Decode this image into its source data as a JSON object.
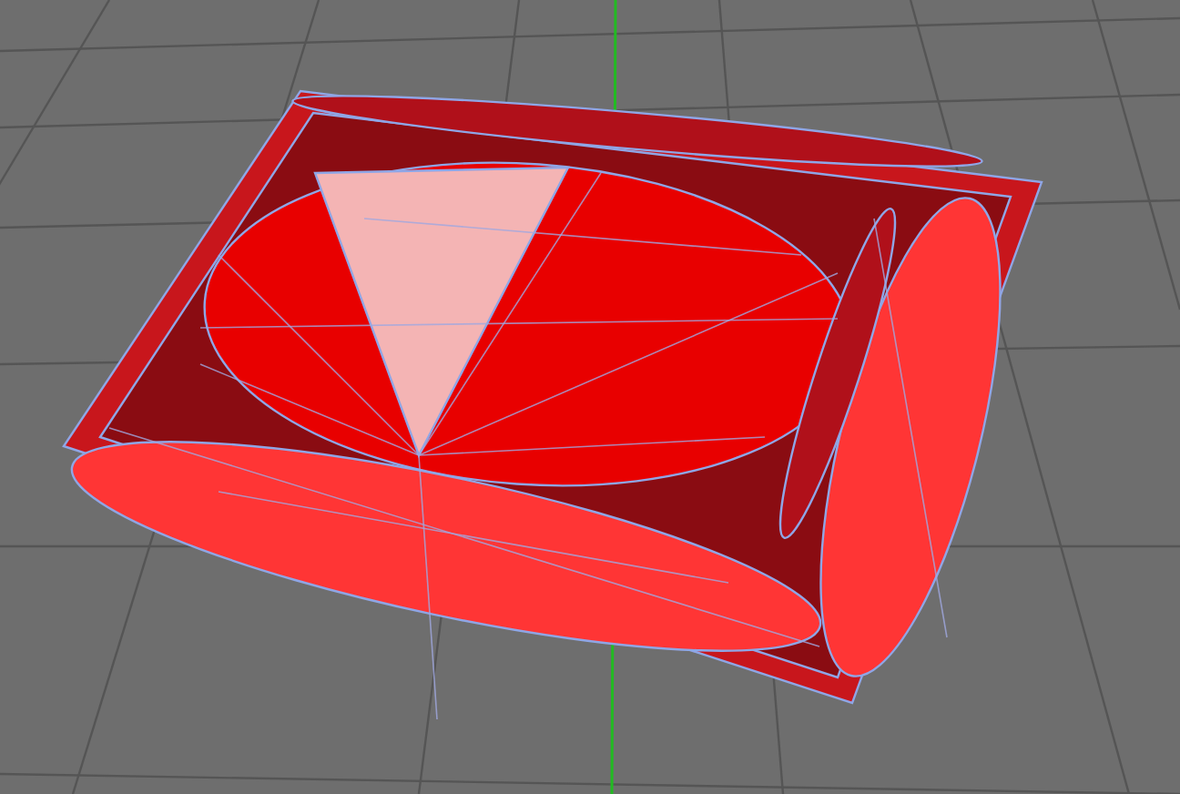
{
  "viewport": {
    "grid_visible": true,
    "y_axis_visible": true,
    "wireframe_visible": true
  }
}
